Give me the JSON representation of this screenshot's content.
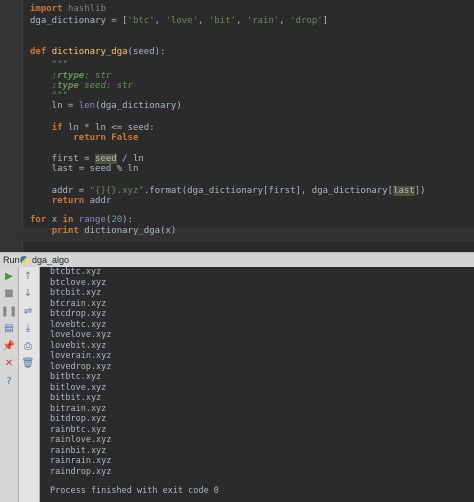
{
  "editor": {
    "lines": [
      {
        "id": "import",
        "parts": [
          {
            "t": "import ",
            "c": "kw"
          },
          {
            "t": "hashlib",
            "c": "dim"
          }
        ]
      },
      {
        "id": "dga-list",
        "parts": [
          {
            "t": "dga_dictionary = [",
            "c": ""
          },
          {
            "t": "'btc'",
            "c": "str"
          },
          {
            "t": ", ",
            "c": ""
          },
          {
            "t": "'love'",
            "c": "str"
          },
          {
            "t": ", ",
            "c": ""
          },
          {
            "t": "'bit'",
            "c": "str"
          },
          {
            "t": ", ",
            "c": ""
          },
          {
            "t": "'rain'",
            "c": "str"
          },
          {
            "t": ", ",
            "c": ""
          },
          {
            "t": "'drop'",
            "c": "str"
          },
          {
            "t": "]",
            "c": ""
          }
        ]
      },
      {
        "id": "blank1",
        "parts": []
      },
      {
        "id": "blank2",
        "parts": []
      },
      {
        "id": "def",
        "parts": [
          {
            "t": "def ",
            "c": "kw"
          },
          {
            "t": "dictionary_dga",
            "c": "fn"
          },
          {
            "t": "(seed):",
            "c": ""
          }
        ]
      },
      {
        "id": "doc-open",
        "parts": [
          {
            "t": "    \"\"\"",
            "c": "cm"
          }
        ]
      },
      {
        "id": "doc-rtype",
        "parts": [
          {
            "t": "    :",
            "c": "cm"
          },
          {
            "t": "rtype",
            "c": "tag"
          },
          {
            "t": ": str",
            "c": "cm"
          }
        ]
      },
      {
        "id": "doc-type",
        "parts": [
          {
            "t": "    :",
            "c": "cm"
          },
          {
            "t": "type",
            "c": "tag"
          },
          {
            "t": " seed: str",
            "c": "cm"
          }
        ]
      },
      {
        "id": "doc-close",
        "parts": [
          {
            "t": "    \"\"\"",
            "c": "cm"
          }
        ]
      },
      {
        "id": "ln-assign",
        "parts": [
          {
            "t": "    ln = ",
            "c": ""
          },
          {
            "t": "len",
            "c": "bi"
          },
          {
            "t": "(dga_dictionary)",
            "c": ""
          }
        ]
      },
      {
        "id": "blank3",
        "parts": []
      },
      {
        "id": "if",
        "parts": [
          {
            "t": "    ",
            "c": ""
          },
          {
            "t": "if ",
            "c": "kw"
          },
          {
            "t": "ln * ln <= seed:",
            "c": ""
          }
        ]
      },
      {
        "id": "return-false",
        "parts": [
          {
            "t": "        ",
            "c": ""
          },
          {
            "t": "return ",
            "c": "kw"
          },
          {
            "t": "False",
            "c": "kw"
          }
        ]
      },
      {
        "id": "blank4",
        "parts": []
      },
      {
        "id": "first",
        "parts": [
          {
            "t": "    first = ",
            "c": ""
          },
          {
            "t": "seed",
            "c": "hl"
          },
          {
            "t": " / ln",
            "c": ""
          }
        ]
      },
      {
        "id": "last",
        "parts": [
          {
            "t": "    last = seed % ln",
            "c": ""
          }
        ]
      },
      {
        "id": "blank5",
        "parts": []
      },
      {
        "id": "addr",
        "parts": [
          {
            "t": "    addr = ",
            "c": ""
          },
          {
            "t": "\"{}{}.xyz\"",
            "c": "str"
          },
          {
            "t": ".format(dga_dictionary[first], dga_dictionary[",
            "c": ""
          },
          {
            "t": "last",
            "c": "hl"
          },
          {
            "t": "])",
            "c": ""
          }
        ]
      },
      {
        "id": "return-addr",
        "parts": [
          {
            "t": "    ",
            "c": ""
          },
          {
            "t": "return ",
            "c": "kw"
          },
          {
            "t": "addr",
            "c": ""
          }
        ]
      },
      {
        "id": "blank6",
        "parts": []
      },
      {
        "id": "for",
        "parts": [
          {
            "t": "for ",
            "c": "kw"
          },
          {
            "t": "x ",
            "c": ""
          },
          {
            "t": "in ",
            "c": "kw"
          },
          {
            "t": "range",
            "c": "bi"
          },
          {
            "t": "(",
            "c": ""
          },
          {
            "t": "20",
            "c": "num"
          },
          {
            "t": "):",
            "c": ""
          }
        ]
      },
      {
        "id": "print",
        "parts": [
          {
            "t": "    ",
            "c": ""
          },
          {
            "t": "print ",
            "c": "kw"
          },
          {
            "t": "dictionary_dga(x)",
            "c": ""
          }
        ]
      }
    ]
  },
  "run_panel": {
    "label": "Run",
    "config_name": "dga_algo"
  },
  "console": {
    "output": [
      "btcbtc.xyz",
      "btclove.xyz",
      "btcbit.xyz",
      "btcrain.xyz",
      "btcdrop.xyz",
      "lovebtc.xyz",
      "lovelove.xyz",
      "lovebit.xyz",
      "loverain.xyz",
      "lovedrop.xyz",
      "bitbtc.xyz",
      "bitlove.xyz",
      "bitbit.xyz",
      "bitrain.xyz",
      "bitdrop.xyz",
      "rainbtc.xyz",
      "rainlove.xyz",
      "rainbit.xyz",
      "rainrain.xyz",
      "raindrop.xyz"
    ],
    "exit_message": "Process finished with exit code 0"
  },
  "toolbar_left": [
    {
      "name": "run-icon",
      "glyph": "▶",
      "color": "#3a9a3a"
    },
    {
      "name": "stop-icon",
      "glyph": "■",
      "color": "#8a8a8a"
    },
    {
      "name": "pause-icon",
      "glyph": "❚❚",
      "color": "#8a8a8a"
    },
    {
      "name": "dump-threads-icon",
      "glyph": "▤",
      "color": "#4a6fa5"
    },
    {
      "name": "pin-icon",
      "glyph": "📌",
      "color": "#c04040"
    },
    {
      "name": "close-icon",
      "glyph": "✕",
      "color": "#d04040"
    },
    {
      "name": "help-icon",
      "glyph": "?",
      "color": "#3b73c8"
    }
  ],
  "toolbar_right": [
    {
      "name": "up-arrow-icon",
      "glyph": "↑",
      "color": "#7a7a7a"
    },
    {
      "name": "down-arrow-icon",
      "glyph": "↓",
      "color": "#7a7a7a"
    },
    {
      "name": "soft-wrap-icon",
      "glyph": "⇌",
      "color": "#4a6fa5"
    },
    {
      "name": "scroll-to-end-icon",
      "glyph": "⤓",
      "color": "#4a6fa5"
    },
    {
      "name": "print-icon",
      "glyph": "⎙",
      "color": "#4a6fa5"
    },
    {
      "name": "trash-icon",
      "glyph": "🗑",
      "color": "#4a6fa5"
    }
  ]
}
